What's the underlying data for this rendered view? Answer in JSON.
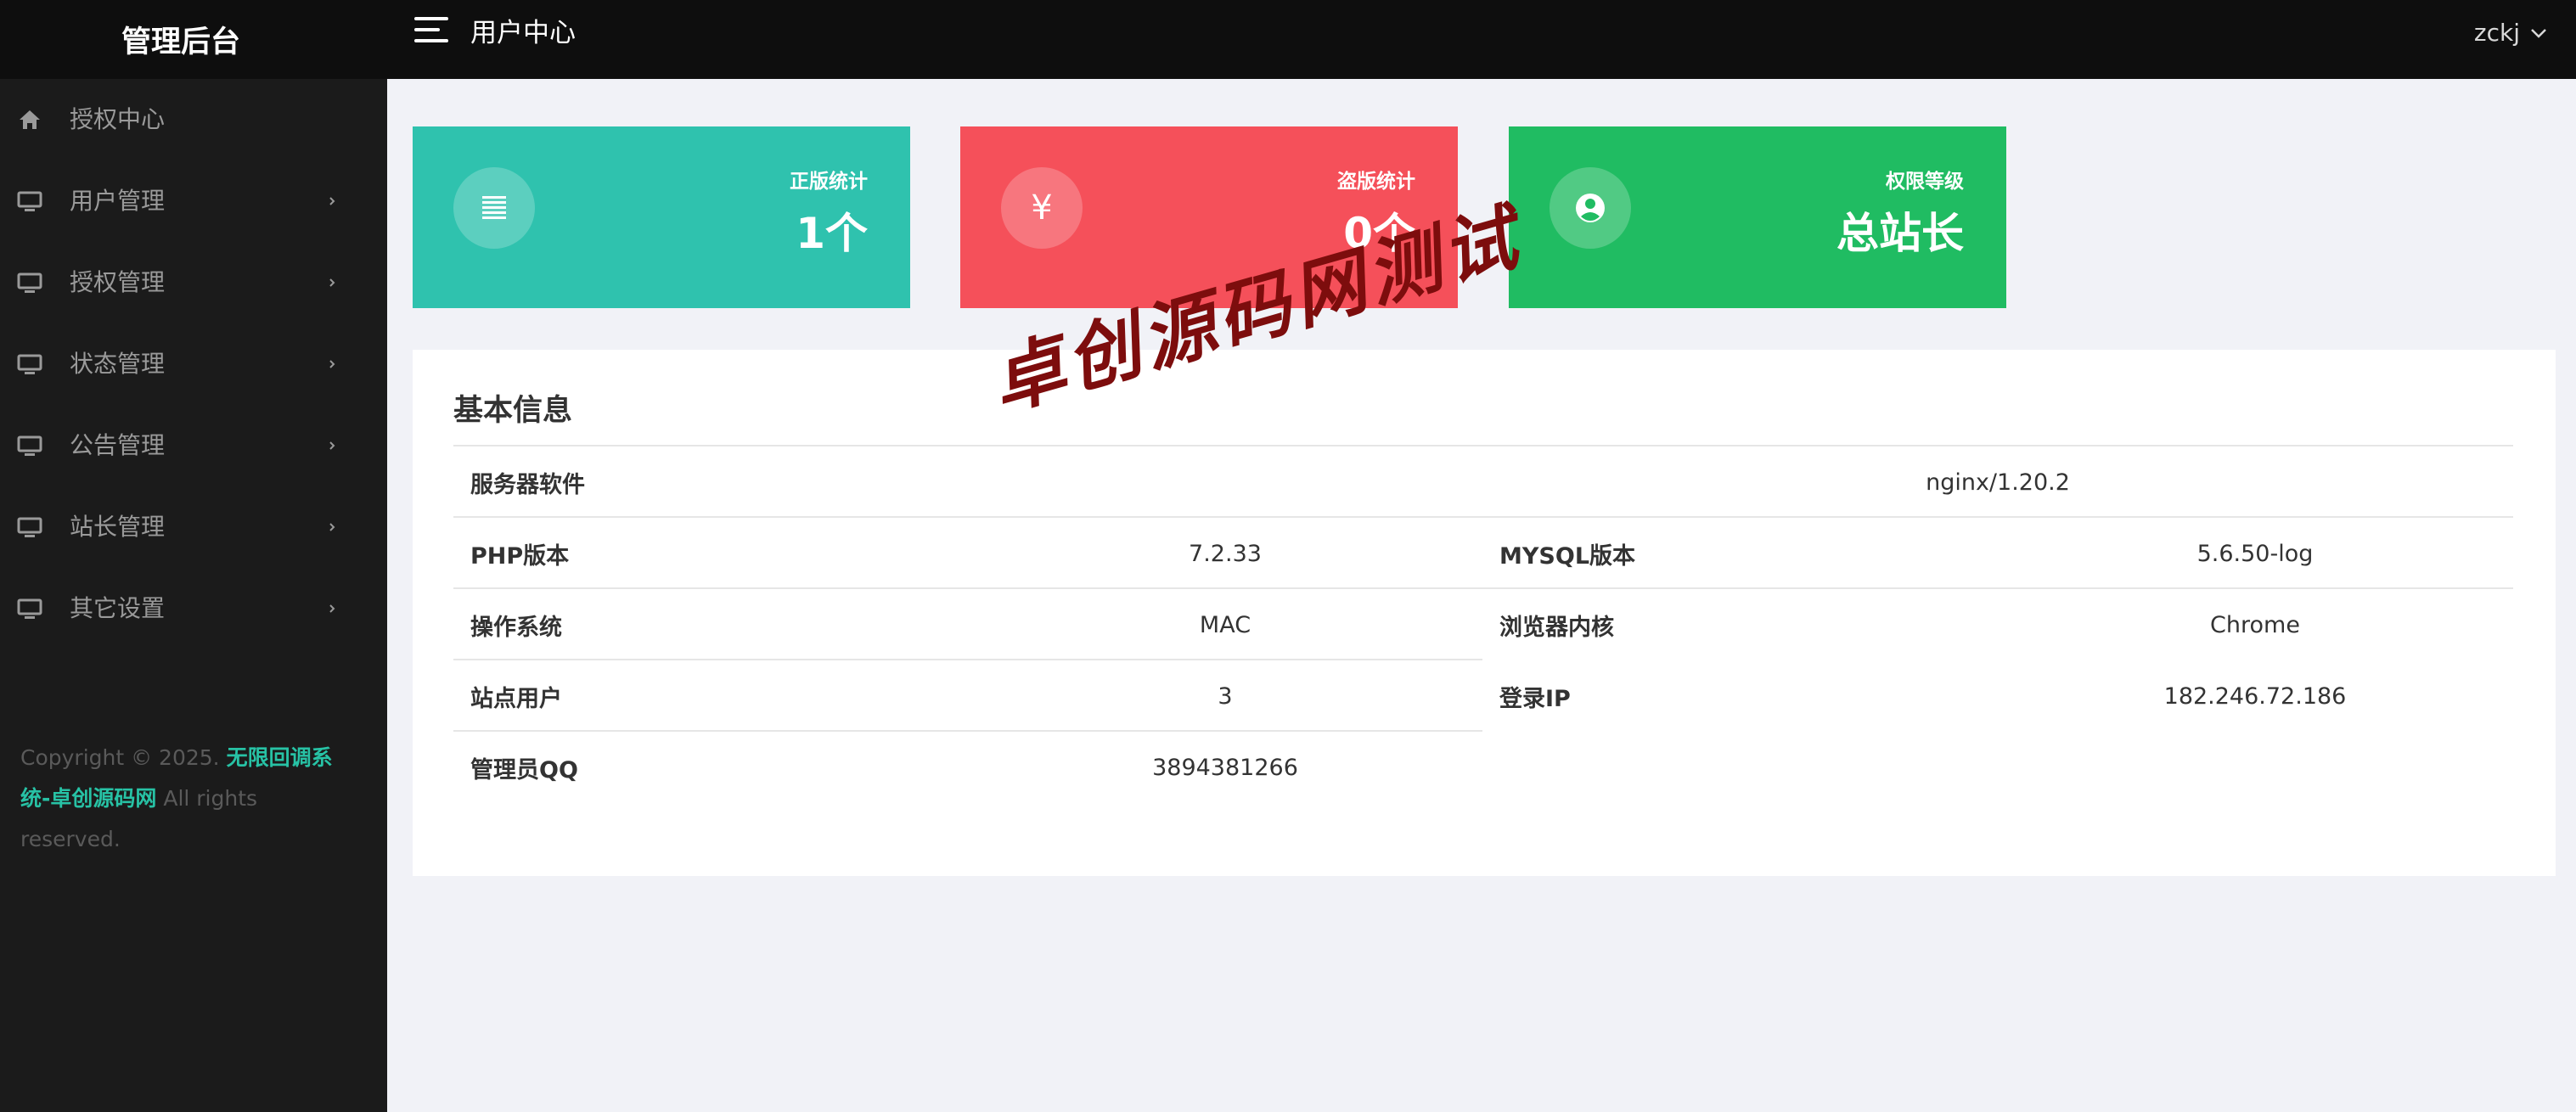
{
  "header": {
    "brand": "管理后台",
    "title": "用户中心",
    "user": "zckj"
  },
  "sidebar": {
    "items": [
      {
        "label": "授权中心",
        "icon": "home-icon"
      },
      {
        "label": "用户管理",
        "icon": "monitor-icon"
      },
      {
        "label": "授权管理",
        "icon": "monitor-icon"
      },
      {
        "label": "状态管理",
        "icon": "monitor-icon"
      },
      {
        "label": "公告管理",
        "icon": "monitor-icon"
      },
      {
        "label": "站长管理",
        "icon": "monitor-icon"
      },
      {
        "label": "其它设置",
        "icon": "monitor-icon"
      }
    ],
    "copyright": {
      "prefix": "Copyright © 2025. ",
      "link": "无限回调系统-卓创源码网",
      "suffix": " All rights reserved."
    }
  },
  "stats": [
    {
      "label": "正版统计",
      "value": "1个",
      "icon": "list-icon",
      "color": "#2fc2ae"
    },
    {
      "label": "盗版统计",
      "value": "0个",
      "icon": "yen-icon",
      "glyph": "¥",
      "color": "#f5505a"
    },
    {
      "label": "权限等级",
      "value": "总站长",
      "icon": "user-circle-icon",
      "color": "#20bc62"
    }
  ],
  "info": {
    "title": "基本信息",
    "server_software": {
      "label": "服务器软件",
      "value": "nginx/1.20.2"
    },
    "php": {
      "label": "PHP版本",
      "value": "7.2.33"
    },
    "mysql": {
      "label": "MYSQL版本",
      "value": "5.6.50-log"
    },
    "os": {
      "label": "操作系统",
      "value": "MAC"
    },
    "browser": {
      "label": "浏览器内核",
      "value": "Chrome"
    },
    "site_users": {
      "label": "站点用户",
      "value": "3"
    },
    "login_ip": {
      "label": "登录IP",
      "value": "182.246.72.186"
    },
    "admin_qq": {
      "label": "管理员QQ",
      "value": "3894381266"
    }
  },
  "watermark": "卓创源码网测试"
}
